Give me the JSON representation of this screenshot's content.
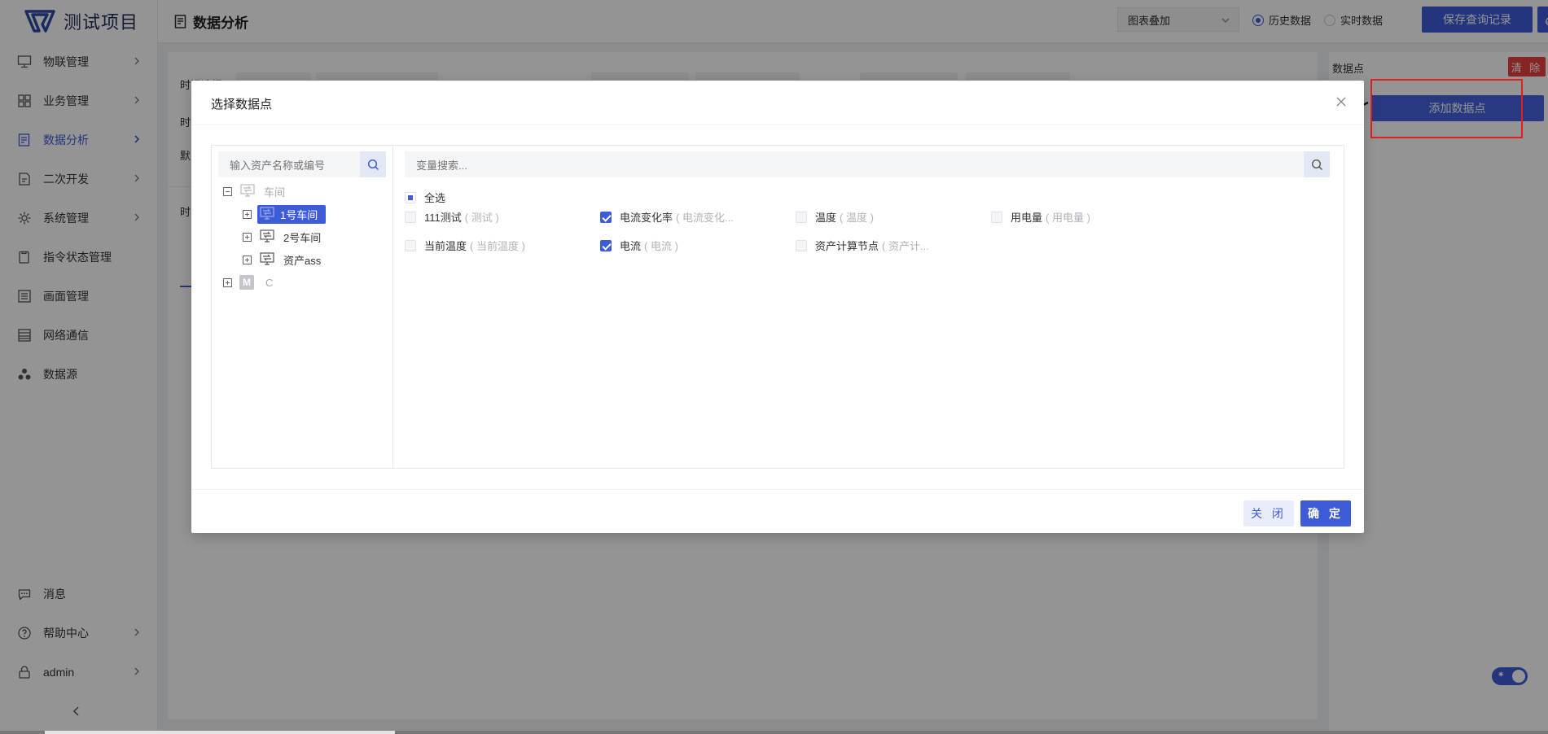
{
  "app": {
    "name": "测试项目"
  },
  "header": {
    "page_title": "数据分析",
    "chart_mode": "图表叠加",
    "radio_history": "历史数据",
    "radio_realtime": "实时数据",
    "save_label": "保存查询记录"
  },
  "sidebar": {
    "items": [
      {
        "label": "物联管理"
      },
      {
        "label": "业务管理"
      },
      {
        "label": "数据分析"
      },
      {
        "label": "二次开发"
      },
      {
        "label": "系统管理"
      },
      {
        "label": "指令状态管理"
      },
      {
        "label": "画面管理"
      },
      {
        "label": "网络通信"
      },
      {
        "label": "数据源"
      }
    ],
    "bottom": [
      {
        "label": "消息"
      },
      {
        "label": "帮助中心"
      },
      {
        "label": "admin"
      }
    ]
  },
  "main": {
    "ghost_labels": [
      "时间选择",
      "时",
      "默",
      "时"
    ]
  },
  "right_panel": {
    "title": "数据点",
    "clear_label": "清 除",
    "add_label": "添加数据点"
  },
  "modal": {
    "title": "选择数据点",
    "tree_search_placeholder": "输入资产名称或编号",
    "var_search_placeholder": "变量搜索...",
    "tree": {
      "root": "车间",
      "children": [
        "1号车间",
        "2号车间",
        "资产ass"
      ],
      "second_root": "C",
      "second_root_badge": "M"
    },
    "select_all": "全选",
    "variables": [
      {
        "name": "111测试",
        "alias": "( 测试 )",
        "checked": false
      },
      {
        "name": "电流变化率",
        "alias": "( 电流变化...",
        "checked": true
      },
      {
        "name": "温度",
        "alias": "( 温度 )",
        "checked": false
      },
      {
        "name": "用电量",
        "alias": "( 用电量 )",
        "checked": false
      },
      {
        "name": "当前温度",
        "alias": "( 当前温度 )",
        "checked": false
      },
      {
        "name": "电流",
        "alias": "( 电流 )",
        "checked": true
      },
      {
        "name": "资产计算节点",
        "alias": "( 资产计...",
        "checked": false
      }
    ],
    "close_label": "关 闭",
    "ok_label": "确 定"
  },
  "colors": {
    "primary": "#3e5bd8",
    "danger": "#e94040",
    "annotation": "#e02020"
  }
}
